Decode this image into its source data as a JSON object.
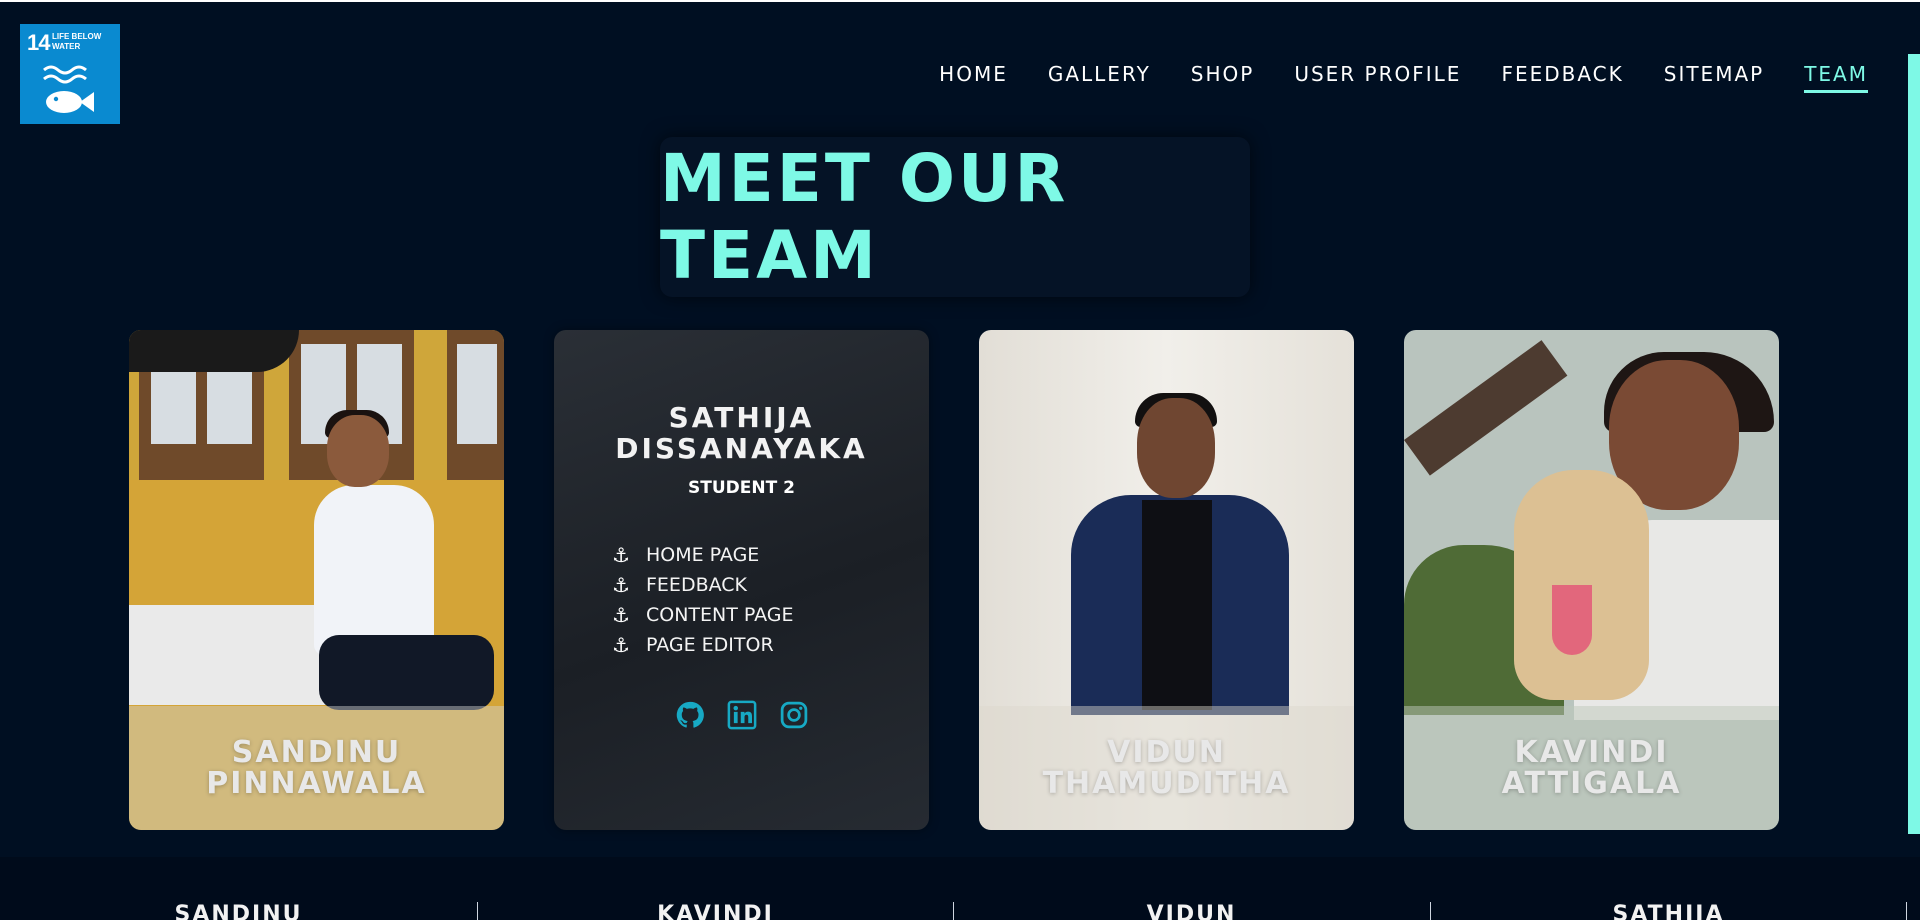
{
  "logo": {
    "number": "14",
    "text": "LIFE BELOW WATER"
  },
  "nav": {
    "items": [
      {
        "label": "HOME"
      },
      {
        "label": "GALLERY"
      },
      {
        "label": "SHOP"
      },
      {
        "label": "USER PROFILE"
      },
      {
        "label": "FEEDBACK"
      },
      {
        "label": "SITEMAP"
      },
      {
        "label": "TEAM",
        "active": true
      }
    ]
  },
  "title": "MEET OUR TEAM",
  "cards": [
    {
      "name_line1": "SANDINU",
      "name_line2": "PINNAWALA"
    },
    {
      "name_line1": "SATHIJA",
      "name_line2": "DISSANAYAKA",
      "role": "STUDENT 2",
      "pages": [
        "HOME PAGE",
        "FEEDBACK",
        "CONTENT PAGE",
        "PAGE EDITOR"
      ],
      "socials": [
        "github-icon",
        "linkedin-icon",
        "instagram-icon"
      ]
    },
    {
      "name_line1": "VIDUN",
      "name_line2": "THAMUDITHA"
    },
    {
      "name_line1": "KAVINDI",
      "name_line2": "ATTIGALA"
    }
  ],
  "footer": {
    "columns": [
      "SANDINU",
      "KAVINDI",
      "VIDUN",
      "SATHIJA"
    ]
  },
  "colors": {
    "accent": "#7ef9e6",
    "background": "#000f22",
    "social": "#17a9c4"
  }
}
